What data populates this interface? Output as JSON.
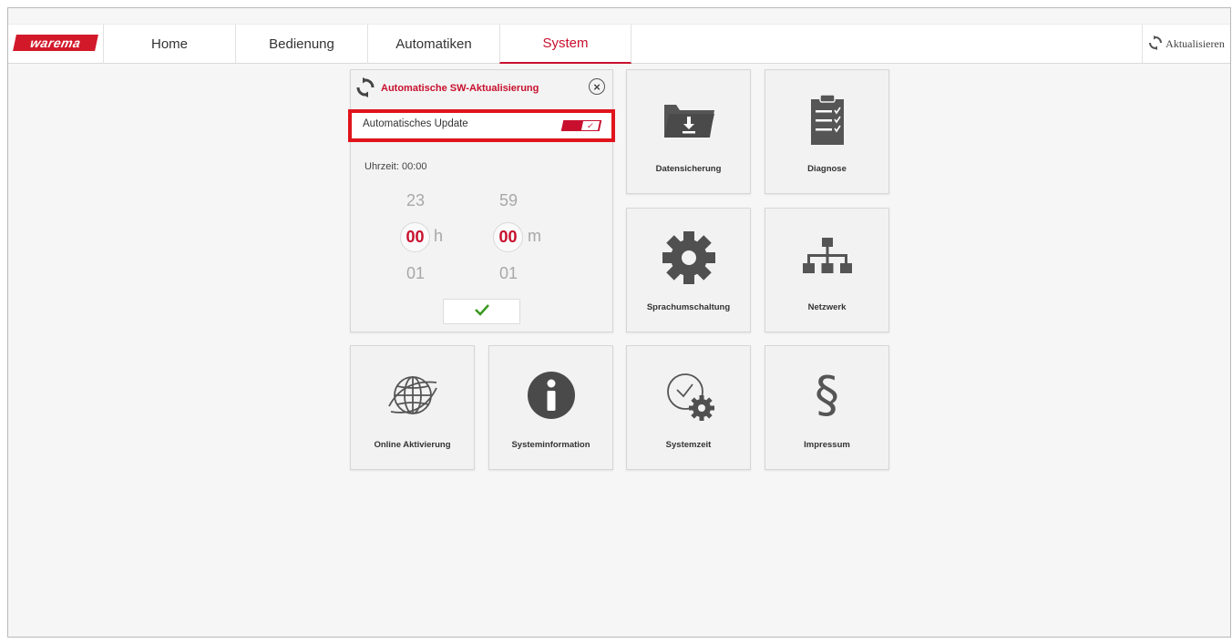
{
  "app": {
    "logo_text": "warema",
    "brand_color": "#c8102e"
  },
  "nav": {
    "tabs": [
      {
        "label": "Home",
        "active": false
      },
      {
        "label": "Bedienung",
        "active": false
      },
      {
        "label": "Automatiken",
        "active": false
      },
      {
        "label": "System",
        "active": true
      }
    ],
    "refresh_label": "Aktualisieren"
  },
  "panel": {
    "title": "Automatische SW-Aktualisierung",
    "auto_update_label": "Automatisches Update",
    "auto_update_enabled": true,
    "time_label": "Uhrzeit: 00:00",
    "hours": {
      "prev": "23",
      "selected": "00",
      "next": "01",
      "unit": "h"
    },
    "minutes": {
      "prev": "59",
      "selected": "00",
      "next": "01",
      "unit": "m"
    }
  },
  "tiles": [
    {
      "label": "Datensicherung",
      "icon": "folder-download-icon"
    },
    {
      "label": "Diagnose",
      "icon": "clipboard-checklist-icon"
    },
    {
      "label": "Sprachumschaltung",
      "icon": "gear-icon"
    },
    {
      "label": "Netzwerk",
      "icon": "network-icon"
    },
    {
      "label": "Online Aktivierung",
      "icon": "globe-icon"
    },
    {
      "label": "Systeminformation",
      "icon": "info-icon"
    },
    {
      "label": "Systemzeit",
      "icon": "clock-gear-icon"
    },
    {
      "label": "Impressum",
      "icon": "paragraph-icon"
    }
  ]
}
